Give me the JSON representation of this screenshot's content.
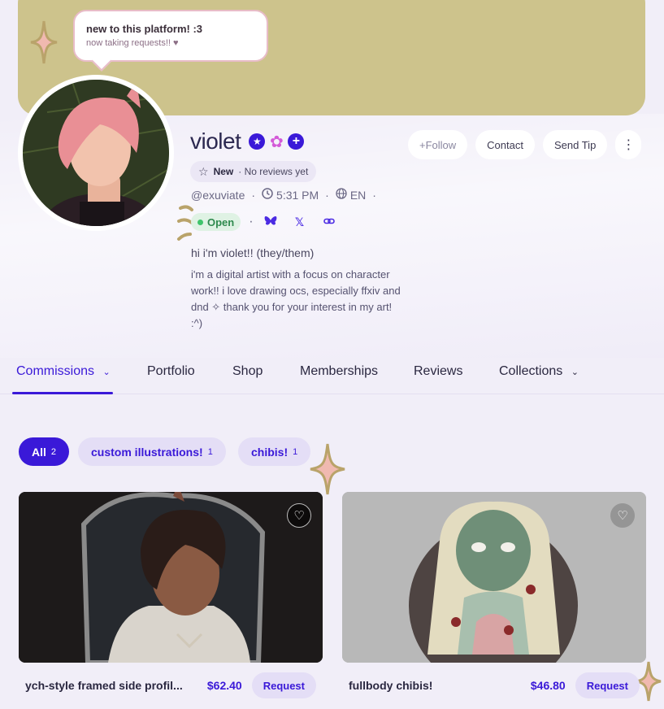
{
  "status_bubble": {
    "title": "new to this platform! :3",
    "subtitle": "now taking requests!! ♥"
  },
  "profile": {
    "name": "violet",
    "badges": [
      "star-badge-icon",
      "flower-badge-icon",
      "plus-badge-icon"
    ],
    "review_label": "New",
    "review_note": "· No reviews yet",
    "handle": "@exuviate",
    "local_time": "5:31 PM",
    "language": "EN",
    "status": "Open",
    "bio_title": "hi i'm violet!! (they/them)",
    "bio": "i'm a digital artist with a focus on character work!! i love drawing ocs, especially ffxiv and dnd ✧ thank you for your interest in my art! :^)"
  },
  "actions": {
    "follow": "+Follow",
    "contact": "Contact",
    "tip": "Send Tip",
    "more": "⋮"
  },
  "tabs": [
    {
      "label": "Commissions",
      "dropdown": true
    },
    {
      "label": "Portfolio"
    },
    {
      "label": "Shop"
    },
    {
      "label": "Memberships"
    },
    {
      "label": "Reviews"
    },
    {
      "label": "Collections",
      "dropdown": true
    }
  ],
  "filters": [
    {
      "label": "All",
      "count": "2"
    },
    {
      "label": "custom illustrations!",
      "count": "1"
    },
    {
      "label": "chibis!",
      "count": "1"
    }
  ],
  "listings": [
    {
      "title": "ych-style framed side profil...",
      "price": "$62.40",
      "button": "Request"
    },
    {
      "title": "fullbody chibis!",
      "price": "$46.80",
      "button": "Request"
    }
  ],
  "colors": {
    "accent": "#3a19d8",
    "banner": "#cdc38c",
    "open": "#2f8a4e"
  }
}
